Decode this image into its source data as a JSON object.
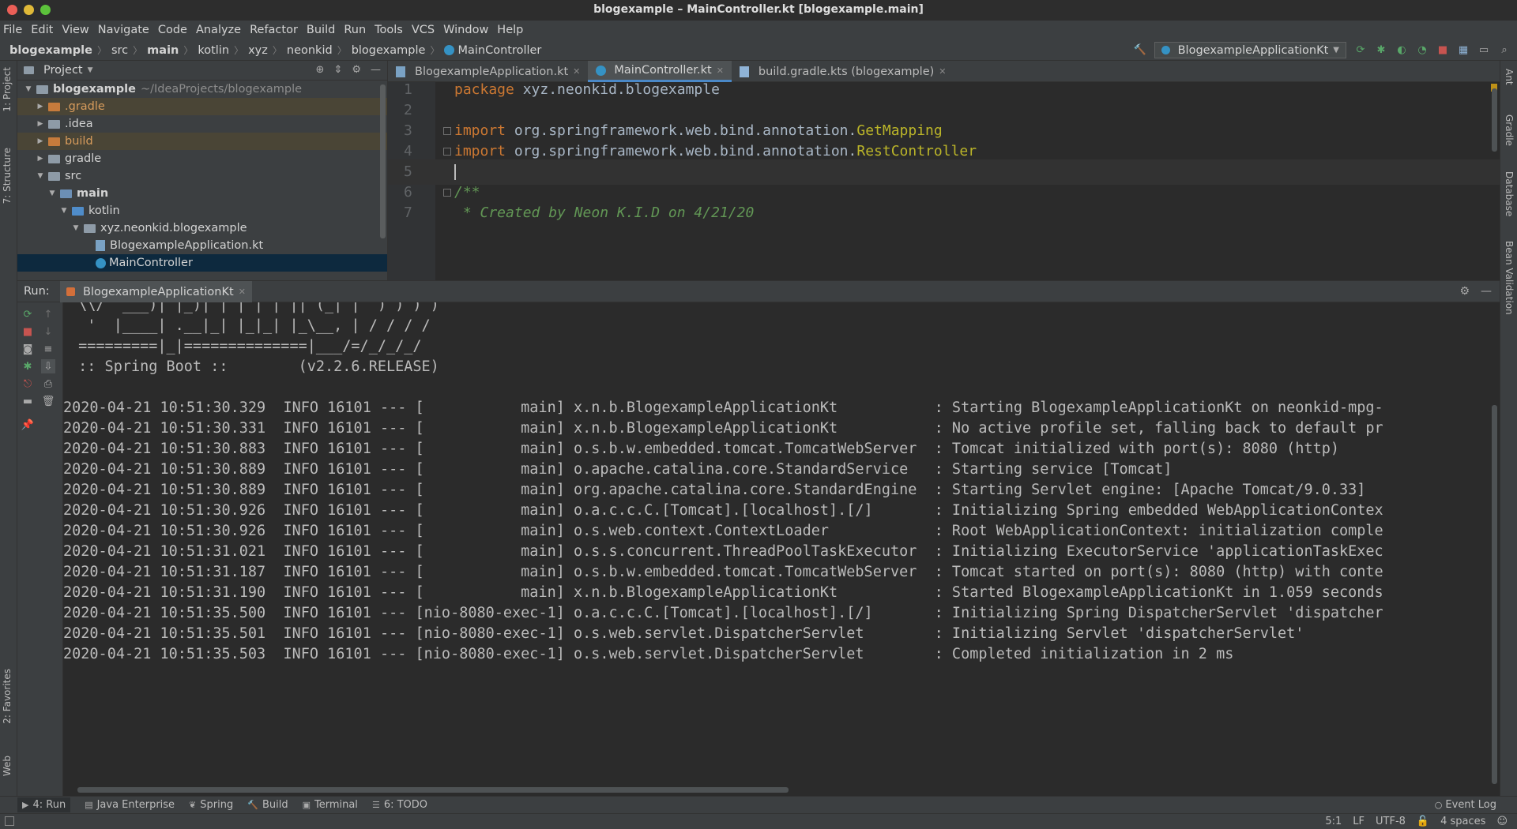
{
  "window": {
    "title": "blogexample – MainController.kt [blogexample.main]"
  },
  "menu": [
    "File",
    "Edit",
    "View",
    "Navigate",
    "Code",
    "Analyze",
    "Refactor",
    "Build",
    "Run",
    "Tools",
    "VCS",
    "Window",
    "Help"
  ],
  "breadcrumbs": [
    "blogexample",
    "src",
    "main",
    "kotlin",
    "xyz",
    "neonkid",
    "blogexample",
    "MainController"
  ],
  "toolbar": {
    "run_config": "BlogexampleApplicationKt"
  },
  "left_strip": {
    "project": "1: Project",
    "structure": "7: Structure",
    "favorites": "2: Favorites",
    "web": "Web"
  },
  "right_strip": {
    "ant": "Ant",
    "gradle": "Gradle",
    "database": "Database",
    "bean_validation": "Bean Validation"
  },
  "project": {
    "title": "Project",
    "tree": [
      {
        "label": "blogexample",
        "suffix": "~/IdeaProjects/blogexample",
        "depth": 0,
        "expanded": true,
        "kind": "module"
      },
      {
        "label": ".gradle",
        "depth": 1,
        "expanded": false,
        "kind": "excluded"
      },
      {
        "label": ".idea",
        "depth": 1,
        "expanded": false,
        "kind": "folder"
      },
      {
        "label": "build",
        "depth": 1,
        "expanded": false,
        "kind": "excluded"
      },
      {
        "label": "gradle",
        "depth": 1,
        "expanded": false,
        "kind": "folder"
      },
      {
        "label": "src",
        "depth": 1,
        "expanded": true,
        "kind": "folder"
      },
      {
        "label": "main",
        "depth": 2,
        "expanded": true,
        "kind": "source"
      },
      {
        "label": "kotlin",
        "depth": 3,
        "expanded": true,
        "kind": "source-root"
      },
      {
        "label": "xyz.neonkid.blogexample",
        "depth": 4,
        "expanded": true,
        "kind": "package"
      },
      {
        "label": "BlogexampleApplication.kt",
        "depth": 5,
        "kind": "kt-file"
      },
      {
        "label": "MainController",
        "depth": 5,
        "kind": "kt-class",
        "selected": true
      }
    ]
  },
  "editor": {
    "tabs": [
      {
        "label": "BlogexampleApplication.kt",
        "active": false
      },
      {
        "label": "MainController.kt",
        "active": true
      },
      {
        "label": "build.gradle.kts (blogexample)",
        "active": false
      }
    ],
    "lines": [
      {
        "n": "1",
        "kw": "package",
        "rest": " xyz.neonkid.blogexample"
      },
      {
        "n": "2",
        "kw": "",
        "rest": ""
      },
      {
        "n": "3",
        "kw": "import",
        "rest": " org.springframework.web.bind.annotation.",
        "ann": "GetMapping"
      },
      {
        "n": "4",
        "kw": "import",
        "rest": " org.springframework.web.bind.annotation.",
        "ann": "RestController"
      },
      {
        "n": "5",
        "kw": "",
        "rest": "",
        "current": true
      },
      {
        "n": "6",
        "doc": "/**"
      },
      {
        "n": "7",
        "doc": " * Created by Neon K.I.D on 4/21/20"
      }
    ]
  },
  "run": {
    "label": "Run:",
    "tab": "BlogexampleApplicationKt",
    "console": [
      " \\\\/  ___)| |_)| | | | | || (_| |  ) ) ) )",
      "  '  |____| .__|_| |_|_| |_\\__, | / / / /",
      " =========|_|==============|___/=/_/_/_/",
      " :: Spring Boot ::        (v2.2.6.RELEASE)",
      "",
      "2020-04-21 10:51:30.329  INFO 16101 --- [           main] x.n.b.BlogexampleApplicationKt           : Starting BlogexampleApplicationKt on neonkid-mpg-",
      "2020-04-21 10:51:30.331  INFO 16101 --- [           main] x.n.b.BlogexampleApplicationKt           : No active profile set, falling back to default pr",
      "2020-04-21 10:51:30.883  INFO 16101 --- [           main] o.s.b.w.embedded.tomcat.TomcatWebServer  : Tomcat initialized with port(s): 8080 (http)",
      "2020-04-21 10:51:30.889  INFO 16101 --- [           main] o.apache.catalina.core.StandardService   : Starting service [Tomcat]",
      "2020-04-21 10:51:30.889  INFO 16101 --- [           main] org.apache.catalina.core.StandardEngine  : Starting Servlet engine: [Apache Tomcat/9.0.33]",
      "2020-04-21 10:51:30.926  INFO 16101 --- [           main] o.a.c.c.C.[Tomcat].[localhost].[/]       : Initializing Spring embedded WebApplicationContex",
      "2020-04-21 10:51:30.926  INFO 16101 --- [           main] o.s.web.context.ContextLoader            : Root WebApplicationContext: initialization comple",
      "2020-04-21 10:51:31.021  INFO 16101 --- [           main] o.s.s.concurrent.ThreadPoolTaskExecutor  : Initializing ExecutorService 'applicationTaskExec",
      "2020-04-21 10:51:31.187  INFO 16101 --- [           main] o.s.b.w.embedded.tomcat.TomcatWebServer  : Tomcat started on port(s): 8080 (http) with conte",
      "2020-04-21 10:51:31.190  INFO 16101 --- [           main] x.n.b.BlogexampleApplicationKt           : Started BlogexampleApplicationKt in 1.059 seconds",
      "2020-04-21 10:51:35.500  INFO 16101 --- [nio-8080-exec-1] o.a.c.c.C.[Tomcat].[localhost].[/]       : Initializing Spring DispatcherServlet 'dispatcher",
      "2020-04-21 10:51:35.501  INFO 16101 --- [nio-8080-exec-1] o.s.web.servlet.DispatcherServlet        : Initializing Servlet 'dispatcherServlet'",
      "2020-04-21 10:51:35.503  INFO 16101 --- [nio-8080-exec-1] o.s.web.servlet.DispatcherServlet        : Completed initialization in 2 ms"
    ]
  },
  "bottom_tabs": [
    {
      "label": "4: Run",
      "icon": "run-icon",
      "active": true
    },
    {
      "label": "Java Enterprise",
      "icon": "java-enterprise-icon"
    },
    {
      "label": "Spring",
      "icon": "spring-icon"
    },
    {
      "label": "Build",
      "icon": "build-icon"
    },
    {
      "label": "Terminal",
      "icon": "terminal-icon"
    },
    {
      "label": "6: TODO",
      "icon": "todo-icon"
    }
  ],
  "event_log": "Event Log",
  "status": {
    "position": "5:1",
    "line_sep": "LF",
    "encoding": "UTF-8",
    "indent": "4 spaces"
  },
  "colors": {
    "accent": "#4a88c7",
    "keyword": "#cc7832",
    "annotation": "#bbb529",
    "doc_comment": "#629755",
    "selection": "#0d293e"
  }
}
